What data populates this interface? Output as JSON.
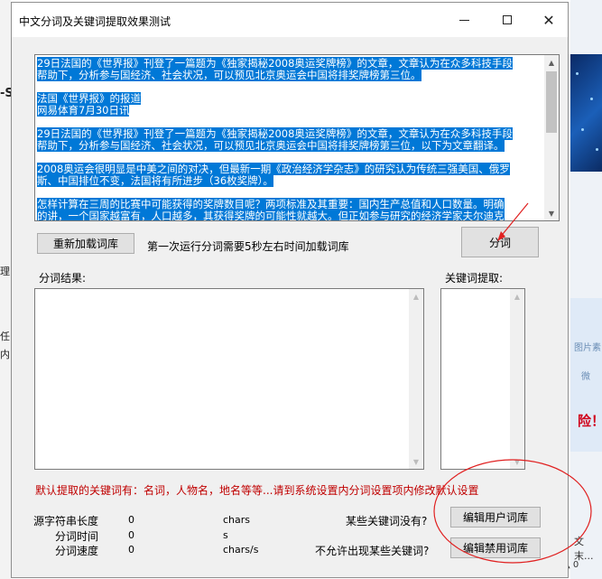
{
  "window": {
    "title": "中文分词及关键词提取效果测试"
  },
  "source": {
    "paragraphs": [
      [
        "29日法国的《世界报》刊登了一篇题为《独家揭秘2008奥运奖牌榜》的文章，文章认为在众多科技手段",
        "帮助下，分析参与国经济、社会状况，可以预见北京奥运会中国将排奖牌榜第三位。"
      ],
      [
        "法国《世界报》的报道",
        "网易体育7月30日讯"
      ],
      [
        "29日法国的《世界报》刊登了一篇题为《独家揭秘2008奥运奖牌榜》的文章，文章认为在众多科技手段",
        "帮助下，分析参与国经济、社会状况，可以预见北京奥运会中国将排奖牌榜第三位，以下为文章翻译。"
      ],
      [
        "2008奥运会很明显是中美之间的对决，但最新一期《政治经济学杂志》的研究认为传统三强美国、俄罗",
        "斯、中国排位不变，法国将有所进步（36枚奖牌）。"
      ],
      [
        "怎样计算在三周的比赛中可能获得的奖牌数目呢？两项标准及其重要：国内生产总值和人口数量。明确",
        "的讲，一个国家越富有，人口越多，其获得奖牌的可能性就越大。但正如参与研究的经济学家夫尔迪克"
      ]
    ]
  },
  "buttons": {
    "reload": "重新加载词库",
    "segment": "分词",
    "edit_user": "编辑用户词库",
    "edit_ban": "编辑禁用词库"
  },
  "labels": {
    "load_note": "第一次运行分词需要5秒左右时间加载词库",
    "result": "分词结果:",
    "keywords": "关键词提取:",
    "default_keywords": "默认提取的关键词有：名词，人物名，地名等等...请到系统设置内分词设置项内修改默认设置",
    "missing_keywords": "某些关键词没有?",
    "banned_keywords": "不允许出现某些关键词?"
  },
  "stats": [
    {
      "label": "源字符串长度",
      "value": "0",
      "unit": "chars"
    },
    {
      "label": "分词时间",
      "value": "0",
      "unit": "s"
    },
    {
      "label": "分词速度",
      "value": "0",
      "unit": "chars/s"
    }
  ],
  "background": {
    "left_s": "-S",
    "left_g": "理",
    "left_r": "任",
    "left_n": "内",
    "right_pic": "图片素",
    "right_wei": "微",
    "right_warn": "险！",
    "right_text": "文末...",
    "right_text2": "▲ 0"
  },
  "colors": {
    "selection": "#0078d7",
    "warning_text": "#c00000",
    "annotation": "#e02020"
  }
}
